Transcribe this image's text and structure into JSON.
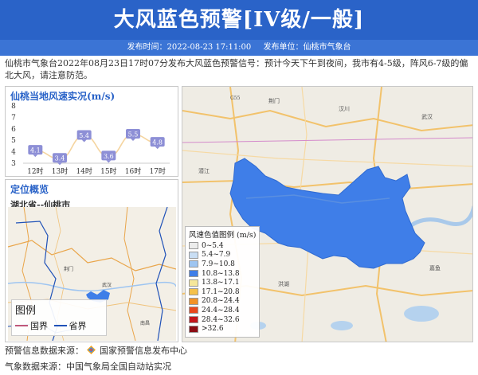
{
  "header": {
    "title": "大风蓝色预警[IV级/一般]",
    "publish_time": "发布时间：2022-08-23 17:11:00",
    "publisher": "发布单位：仙桃市气象台"
  },
  "description": "仙桃市气象台2022年08月23日17时07分发布大风蓝色预警信号：预计今天下午到夜间，我市有4-5级，阵风6-7级的偏北大风，请注意防范。",
  "wind_panel": {
    "title": "仙桃当地风速实况(m/s)"
  },
  "chart_data": {
    "type": "line",
    "title": "仙桃当地风速实况(m/s)",
    "categories": [
      "12时",
      "13时",
      "14时",
      "15时",
      "16时",
      "17时"
    ],
    "values": [
      4.1,
      3.4,
      5.4,
      3.6,
      5.5,
      4.8
    ],
    "yticks": [
      "3",
      "4",
      "5",
      "6",
      "7",
      "8"
    ],
    "ylim": [
      3,
      8
    ],
    "line_color": "#f5d5a0",
    "marker_color": "#8d8fd6"
  },
  "location": {
    "title": "定位概览",
    "region": "湖北省--仙桃市",
    "legend_title": "图例",
    "legend_items": [
      {
        "label": "国界",
        "color": "#c0587a"
      },
      {
        "label": "省界",
        "color": "#2052b8"
      }
    ]
  },
  "map": {
    "legend_title": "风速色值图例 (m/s)",
    "legend": [
      {
        "label": "0~5.4",
        "color": "#ececec"
      },
      {
        "label": "5.4~7.9",
        "color": "#c9def4"
      },
      {
        "label": "7.9~10.8",
        "color": "#9ec5f1"
      },
      {
        "label": "10.8~13.8",
        "color": "#3f7ee8"
      },
      {
        "label": "13.8~17.1",
        "color": "#f6e79a"
      },
      {
        "label": "17.1~20.8",
        "color": "#f5c14a"
      },
      {
        "label": "20.8~24.4",
        "color": "#f29227"
      },
      {
        "label": "24.4~28.4",
        "color": "#e8481d"
      },
      {
        "label": "28.4~32.6",
        "color": "#c4161c"
      },
      {
        "label": ">32.6",
        "color": "#8b0c13"
      }
    ],
    "region_color": "#3f7ee8"
  },
  "footer": {
    "warning_source_label": "预警信息数据来源：",
    "warning_source": "国家预警信息发布中心",
    "weather_source": "气象数据来源：中国气象局全国自动站实况"
  }
}
